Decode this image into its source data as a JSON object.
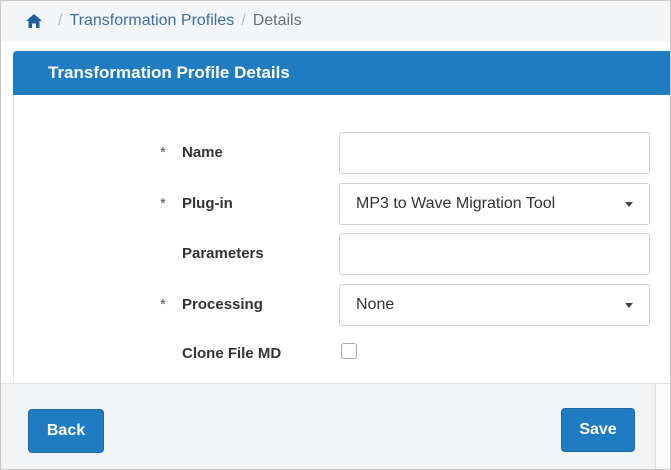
{
  "breadcrumb": {
    "home_icon": "home-icon",
    "separator": "/",
    "items": [
      "Transformation Profiles",
      "Details"
    ]
  },
  "panel": {
    "title": "Transformation Profile Details",
    "header_color": "#1f7cc1"
  },
  "form": {
    "required_mark": "*",
    "name": {
      "label": "Name",
      "value": ""
    },
    "plugin": {
      "label": "Plug-in",
      "value": "MP3 to Wave Migration Tool"
    },
    "parameters": {
      "label": "Parameters",
      "value": ""
    },
    "processing": {
      "label": "Processing",
      "value": "None"
    },
    "clone": {
      "label": "Clone File MD",
      "checked": false
    }
  },
  "footer": {
    "back_label": "Back",
    "save_label": "Save"
  }
}
